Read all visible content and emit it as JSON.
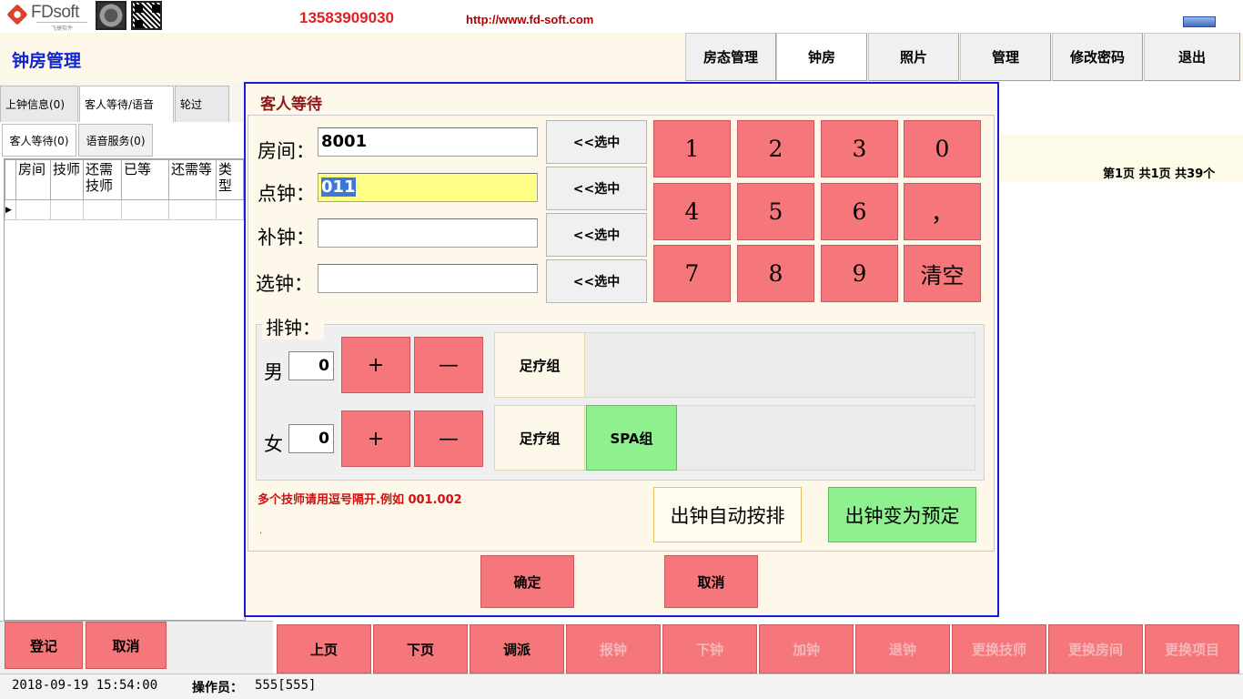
{
  "header": {
    "logo_text": "FDsoft",
    "logo_sub": "飞捷软件",
    "phone": "13583909030",
    "url": "http://www.fd-soft.com"
  },
  "title": "钟房管理",
  "nav": [
    "房态管理",
    "钟房",
    "照片",
    "管理",
    "修改密码",
    "退出"
  ],
  "left": {
    "tabs": [
      "上钟信息(0)",
      "客人等待/语音",
      "轮过"
    ],
    "subtabs": [
      "客人等待(0)",
      "语音服务(0)"
    ],
    "columns": [
      "房间",
      "技师",
      "还需技师",
      "已等",
      "还需等",
      "类型"
    ],
    "register_button": "登记",
    "cancel_button": "取消"
  },
  "right": {
    "page_info": "第1页 共1页 共39个"
  },
  "bottom_nav": [
    "上页",
    "下页",
    "调派",
    "报钟",
    "下钟",
    "加钟",
    "退钟",
    "更换技师",
    "更换房间",
    "更换项目"
  ],
  "status": {
    "datetime": "2018-09-19 15:54:00",
    "operator_label": "操作员：",
    "operator": "555[555]"
  },
  "dialog": {
    "title": "客人等待",
    "fields": [
      {
        "label": "房间：",
        "value": "8001"
      },
      {
        "label": "点钟：",
        "value": "011"
      },
      {
        "label": "补钟：",
        "value": ""
      },
      {
        "label": "选钟：",
        "value": ""
      }
    ],
    "select_button": "<<选中",
    "keypad": [
      "1",
      "2",
      "3",
      "0",
      "4",
      "5",
      "6",
      "，",
      "7",
      "8",
      "9",
      "清空"
    ],
    "schedule_label": "排钟：",
    "male_label": "男",
    "male_count": "0",
    "female_label": "女",
    "female_count": "0",
    "plus": "+",
    "minus": "—",
    "male_groups": [
      "足疗组"
    ],
    "female_groups": [
      "足疗组",
      "SPA组"
    ],
    "hint": "多个技师请用逗号隔开.例如 001.002",
    "hint_dot": ".",
    "auto_button": "出钟自动按排",
    "preset_button": "出钟变为预定",
    "ok_button": "确定",
    "cancel_button": "取消"
  }
}
